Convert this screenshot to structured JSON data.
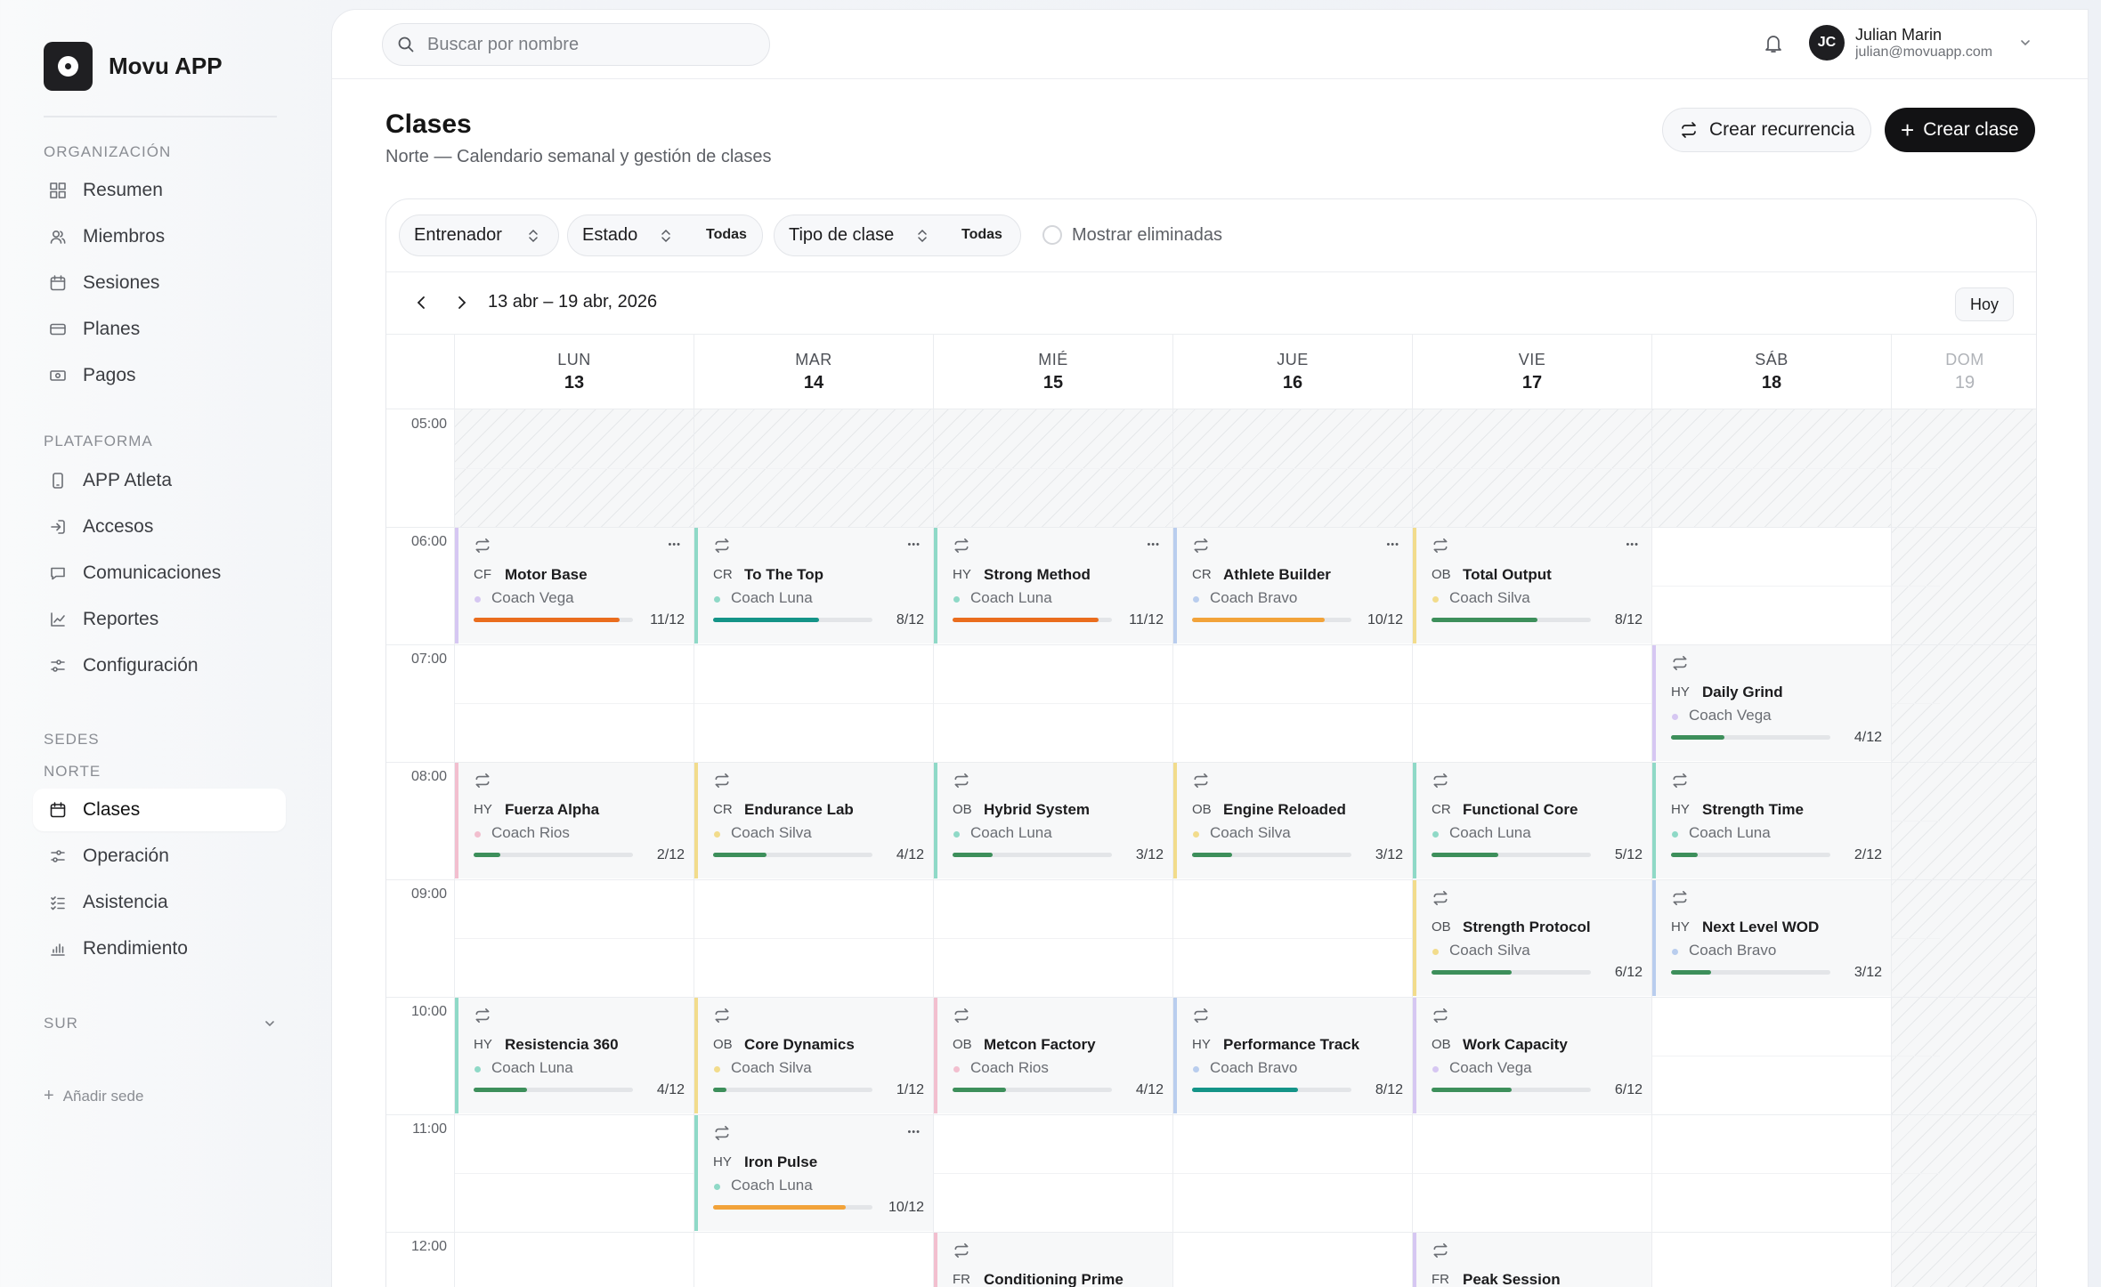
{
  "app": {
    "name": "Movu APP"
  },
  "sidebar": {
    "org_title": "ORGANIZACIÓN",
    "org_items": [
      {
        "label": "Resumen",
        "icon": "grid-icon"
      },
      {
        "label": "Miembros",
        "icon": "users-icon"
      },
      {
        "label": "Sesiones",
        "icon": "calendar-icon"
      },
      {
        "label": "Planes",
        "icon": "card-icon"
      },
      {
        "label": "Pagos",
        "icon": "cash-icon"
      }
    ],
    "platform_title": "PLATAFORMA",
    "platform_items": [
      {
        "label": "APP Atleta",
        "icon": "phone-icon"
      },
      {
        "label": "Accesos",
        "icon": "login-icon"
      },
      {
        "label": "Comunicaciones",
        "icon": "message-icon"
      },
      {
        "label": "Reportes",
        "icon": "chart-line-icon"
      },
      {
        "label": "Configuración",
        "icon": "sliders-icon"
      }
    ],
    "sedes_title": "SEDES",
    "sede_norte": "NORTE",
    "norte_items": [
      {
        "label": "Clases",
        "icon": "calendar-icon",
        "active": true
      },
      {
        "label": "Operación",
        "icon": "sliders-icon"
      },
      {
        "label": "Asistencia",
        "icon": "checklist-icon"
      },
      {
        "label": "Rendimiento",
        "icon": "bar-chart-icon"
      }
    ],
    "sede_sur": "SUR",
    "add_sede": "Añadir sede"
  },
  "topbar": {
    "search_placeholder": "Buscar por nombre",
    "user_initials": "JC",
    "user_name": "Julian Marin",
    "user_email": "julian@movuapp.com"
  },
  "page": {
    "title": "Clases",
    "subtitle": "Norte — Calendario semanal y gestión de clases",
    "btn_recurrence": "Crear recurrencia",
    "btn_create": "Crear clase"
  },
  "filters": {
    "trainer": "Entrenador",
    "status": "Estado",
    "status_value": "Todas",
    "class_type": "Tipo de clase",
    "class_type_value": "Todas",
    "show_deleted": "Mostrar eliminadas"
  },
  "calendar": {
    "range": "13 abr – 19 abr, 2026",
    "today": "Hoy",
    "days": [
      {
        "name": "LUN",
        "date": "13"
      },
      {
        "name": "MAR",
        "date": "14"
      },
      {
        "name": "MIÉ",
        "date": "15"
      },
      {
        "name": "JUE",
        "date": "16"
      },
      {
        "name": "VIE",
        "date": "17"
      },
      {
        "name": "SÁB",
        "date": "18"
      },
      {
        "name": "DOM",
        "date": "19",
        "muted": true
      }
    ],
    "hours": [
      "05:00",
      "06:00",
      "07:00",
      "08:00",
      "09:00",
      "10:00",
      "11:00",
      "12:00"
    ],
    "colors": {
      "purple": "#d6c7f2",
      "teal": "#8fd9c7",
      "blue": "#b9cdee",
      "yellow": "#f2dc8c",
      "pink": "#f2bfcf",
      "bar_orange": "#ea6d1e",
      "bar_amber": "#f2a33a",
      "bar_teal": "#149488",
      "bar_green": "#3d8f5b"
    },
    "events": [
      {
        "day": 0,
        "start": 6,
        "code": "CF",
        "title": "Motor Base",
        "coach": "Coach Vega",
        "count": "11/12",
        "filled": 11,
        "total": 12,
        "border": "purple",
        "bar": "bar_orange",
        "menu": true
      },
      {
        "day": 1,
        "start": 6,
        "code": "CR",
        "title": "To The Top",
        "coach": "Coach Luna",
        "count": "8/12",
        "filled": 8,
        "total": 12,
        "border": "teal",
        "bar": "bar_teal",
        "menu": true
      },
      {
        "day": 2,
        "start": 6,
        "code": "HY",
        "title": "Strong Method",
        "coach": "Coach Luna",
        "count": "11/12",
        "filled": 11,
        "total": 12,
        "border": "teal",
        "bar": "bar_orange",
        "menu": true
      },
      {
        "day": 3,
        "start": 6,
        "code": "CR",
        "title": "Athlete Builder",
        "coach": "Coach Bravo",
        "count": "10/12",
        "filled": 10,
        "total": 12,
        "border": "blue",
        "bar": "bar_amber",
        "menu": true
      },
      {
        "day": 4,
        "start": 6,
        "code": "OB",
        "title": "Total Output",
        "coach": "Coach Silva",
        "count": "8/12",
        "filled": 8,
        "total": 12,
        "border": "yellow",
        "bar": "bar_green",
        "menu": true
      },
      {
        "day": 5,
        "start": 7,
        "code": "HY",
        "title": "Daily Grind",
        "coach": "Coach Vega",
        "count": "4/12",
        "filled": 4,
        "total": 12,
        "border": "purple",
        "bar": "bar_green"
      },
      {
        "day": 0,
        "start": 8,
        "code": "HY",
        "title": "Fuerza Alpha",
        "coach": "Coach Rios",
        "count": "2/12",
        "filled": 2,
        "total": 12,
        "border": "pink",
        "bar": "bar_green"
      },
      {
        "day": 1,
        "start": 8,
        "code": "CR",
        "title": "Endurance Lab",
        "coach": "Coach Silva",
        "count": "4/12",
        "filled": 4,
        "total": 12,
        "border": "yellow",
        "bar": "bar_green"
      },
      {
        "day": 2,
        "start": 8,
        "code": "OB",
        "title": "Hybrid System",
        "coach": "Coach Luna",
        "count": "3/12",
        "filled": 3,
        "total": 12,
        "border": "teal",
        "bar": "bar_green"
      },
      {
        "day": 3,
        "start": 8,
        "code": "OB",
        "title": "Engine Reloaded",
        "coach": "Coach Silva",
        "count": "3/12",
        "filled": 3,
        "total": 12,
        "border": "yellow",
        "bar": "bar_green"
      },
      {
        "day": 4,
        "start": 8,
        "code": "CR",
        "title": "Functional Core",
        "coach": "Coach Luna",
        "count": "5/12",
        "filled": 5,
        "total": 12,
        "border": "teal",
        "bar": "bar_green"
      },
      {
        "day": 5,
        "start": 8,
        "code": "HY",
        "title": "Strength Time",
        "coach": "Coach Luna",
        "count": "2/12",
        "filled": 2,
        "total": 12,
        "border": "teal",
        "bar": "bar_green"
      },
      {
        "day": 4,
        "start": 9,
        "code": "OB",
        "title": "Strength Protocol",
        "coach": "Coach Silva",
        "count": "6/12",
        "filled": 6,
        "total": 12,
        "border": "yellow",
        "bar": "bar_green"
      },
      {
        "day": 5,
        "start": 9,
        "code": "HY",
        "title": "Next Level WOD",
        "coach": "Coach Bravo",
        "count": "3/12",
        "filled": 3,
        "total": 12,
        "border": "blue",
        "bar": "bar_green"
      },
      {
        "day": 0,
        "start": 10,
        "code": "HY",
        "title": "Resistencia 360",
        "coach": "Coach Luna",
        "count": "4/12",
        "filled": 4,
        "total": 12,
        "border": "teal",
        "bar": "bar_green"
      },
      {
        "day": 1,
        "start": 10,
        "code": "OB",
        "title": "Core Dynamics",
        "coach": "Coach Silva",
        "count": "1/12",
        "filled": 1,
        "total": 12,
        "border": "yellow",
        "bar": "bar_green"
      },
      {
        "day": 2,
        "start": 10,
        "code": "OB",
        "title": "Metcon Factory",
        "coach": "Coach Rios",
        "count": "4/12",
        "filled": 4,
        "total": 12,
        "border": "pink",
        "bar": "bar_green"
      },
      {
        "day": 3,
        "start": 10,
        "code": "HY",
        "title": "Performance Track",
        "coach": "Coach Bravo",
        "count": "8/12",
        "filled": 8,
        "total": 12,
        "border": "blue",
        "bar": "bar_teal"
      },
      {
        "day": 4,
        "start": 10,
        "code": "OB",
        "title": "Work Capacity",
        "coach": "Coach Vega",
        "count": "6/12",
        "filled": 6,
        "total": 12,
        "border": "purple",
        "bar": "bar_green"
      },
      {
        "day": 1,
        "start": 11,
        "code": "HY",
        "title": "Iron Pulse",
        "coach": "Coach Luna",
        "count": "10/12",
        "filled": 10,
        "total": 12,
        "border": "teal",
        "bar": "bar_amber",
        "menu": true
      },
      {
        "day": 2,
        "start": 12,
        "code": "FR",
        "title": "Conditioning Prime",
        "coach": "",
        "count": "",
        "filled": 0,
        "total": 12,
        "border": "pink",
        "bar": "bar_green",
        "cut": true
      },
      {
        "day": 4,
        "start": 12,
        "code": "FR",
        "title": "Peak Session",
        "coach": "",
        "count": "",
        "filled": 0,
        "total": 12,
        "border": "purple",
        "bar": "bar_green",
        "cut": true
      }
    ]
  }
}
